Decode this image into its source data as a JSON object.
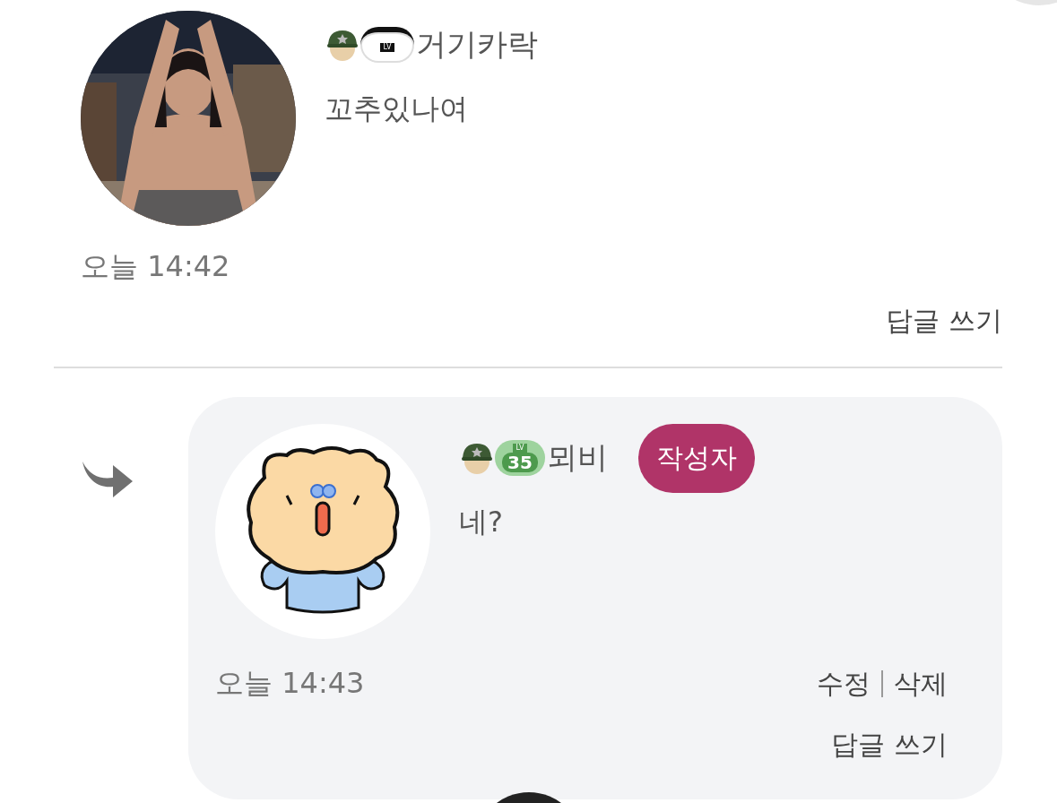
{
  "comments": [
    {
      "kind": "comment",
      "author": "거기카락",
      "level_badge": {
        "label": "LV"
      },
      "text": "꼬추있나여",
      "time": "오늘 14:42",
      "reply_link": "답글 쓰기"
    },
    {
      "kind": "reply",
      "avatar": {
        "kind": "drawing"
      },
      "author": "뫼비",
      "level_badge": {
        "label": "LV",
        "number": "35"
      },
      "author_tag": "작성자",
      "text": "네?",
      "time": "오늘 14:43",
      "actions": [
        "수정",
        "삭제"
      ],
      "reply_link": "답글 쓰기"
    }
  ]
}
